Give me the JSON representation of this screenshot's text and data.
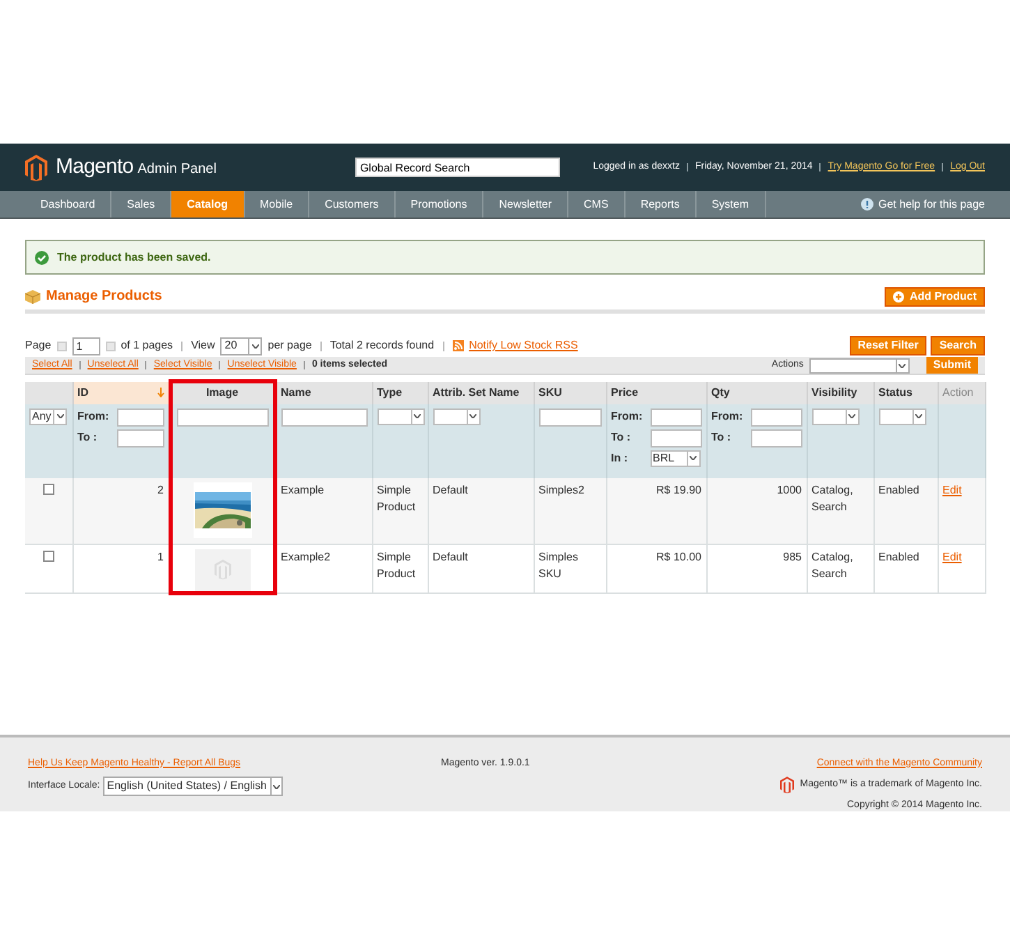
{
  "header": {
    "logo": "Magento",
    "logo_suffix": "Admin Panel",
    "search": {
      "value": "Global Record Search"
    },
    "user": "Logged in as dexxtz",
    "date": "Friday, November 21, 2014",
    "links": [
      "Try Magento Go for Free",
      "Log Out"
    ]
  },
  "nav": {
    "items": [
      {
        "label": "Dashboard",
        "selected": false
      },
      {
        "label": "Sales",
        "selected": false
      },
      {
        "label": "Catalog",
        "selected": true
      },
      {
        "label": "Mobile",
        "selected": false
      },
      {
        "label": "Customers",
        "selected": false
      },
      {
        "label": "Promotions",
        "selected": false
      },
      {
        "label": "Newsletter",
        "selected": false
      },
      {
        "label": "CMS",
        "selected": false
      },
      {
        "label": "Reports",
        "selected": false
      },
      {
        "label": "System",
        "selected": false
      }
    ],
    "help": "Get help for this page"
  },
  "message": "The product has been saved.",
  "page_title": "Manage Products",
  "add_button": "Add Product",
  "pager": {
    "page_label": "Page",
    "page": "1",
    "of": "of 1 pages",
    "view_label": "View",
    "view": "20",
    "per_page": "per page",
    "total": "Total 2 records found",
    "rss": "Notify Low Stock RSS"
  },
  "grid_buttons": [
    "Reset Filter",
    "Search"
  ],
  "massaction": {
    "links": [
      "Select All",
      "Unselect All",
      "Select Visible",
      "Unselect Visible"
    ],
    "selected": "0 items selected",
    "actions_label": "Actions",
    "submit": "Submit"
  },
  "columns": [
    {
      "sorted": false,
      "highlighted": false,
      "filter": {
        "kind": "select",
        "value": "Any"
      }
    },
    {
      "label": "ID",
      "sorted": true,
      "highlighted": false,
      "filter": {
        "kind": "range",
        "from": "From:",
        "to": "To :"
      }
    },
    {
      "label": "Image",
      "sorted": false,
      "highlighted": true,
      "filter": {
        "kind": "text"
      }
    },
    {
      "label": "Name",
      "sorted": false,
      "highlighted": false,
      "filter": {
        "kind": "text"
      }
    },
    {
      "label": "Type",
      "sorted": false,
      "highlighted": false,
      "filter": {
        "kind": "select"
      }
    },
    {
      "label": "Attrib. Set Name",
      "sorted": false,
      "highlighted": false,
      "filter": {
        "kind": "select"
      }
    },
    {
      "label": "SKU",
      "sorted": false,
      "highlighted": false,
      "filter": {
        "kind": "text"
      }
    },
    {
      "label": "Price",
      "sorted": false,
      "highlighted": false,
      "filter": {
        "kind": "range",
        "from": "From:",
        "to": "To :",
        "currency_label": "In :",
        "currency": "BRL"
      }
    },
    {
      "label": "Qty",
      "sorted": false,
      "highlighted": false,
      "filter": {
        "kind": "range",
        "from": "From:",
        "to": "To :"
      }
    },
    {
      "label": "Visibility",
      "sorted": false,
      "highlighted": false,
      "filter": {
        "kind": "select"
      }
    },
    {
      "label": "Status",
      "sorted": false,
      "highlighted": false,
      "filter": {
        "kind": "select"
      }
    },
    {
      "label": "Action",
      "sorted": false,
      "highlighted": false,
      "filter": {
        "kind": "none"
      }
    }
  ],
  "rows": [
    {
      "checked": false,
      "id": "2",
      "name": "Example",
      "type": "Simple Product",
      "attrib": "Default",
      "sku": "Simples2",
      "price": "R$ 19.90",
      "qty": "1000",
      "visibility": "Catalog, Search",
      "status": "Enabled",
      "action": "Edit"
    },
    {
      "checked": false,
      "id": "1",
      "image": {
        "kind": "placeholder"
      },
      "name": "Example2",
      "type": "Simple Product",
      "attrib": "Default",
      "sku": "Simples SKU",
      "price": "R$ 10.00",
      "qty": "985",
      "visibility": "Catalog, Search",
      "status": "Enabled",
      "action": "Edit"
    }
  ],
  "footer": {
    "bug_link": "Help Us Keep Magento Healthy - Report All Bugs",
    "locale_label": "Interface Locale:",
    "locale": "English (United States) / English",
    "version": "Magento ver. 1.9.0.1",
    "community": "Connect with the Magento Community",
    "trademark": "Magento™ is a trademark of Magento Inc.",
    "copyright": "Copyright © 2014 Magento Inc."
  }
}
